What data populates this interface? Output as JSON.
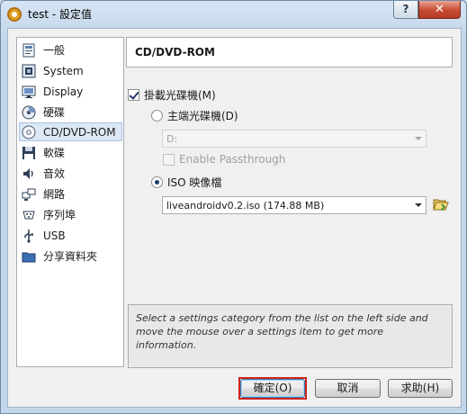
{
  "window": {
    "title": "test - 設定值",
    "help_label": "?",
    "close_label": "✕"
  },
  "sidebar": {
    "items": [
      {
        "label": "一般",
        "icon": "general-icon"
      },
      {
        "label": "System",
        "icon": "system-icon"
      },
      {
        "label": "Display",
        "icon": "display-icon"
      },
      {
        "label": "硬碟",
        "icon": "hard-disk-icon"
      },
      {
        "label": "CD/DVD-ROM",
        "icon": "cd-dvd-icon",
        "selected": true
      },
      {
        "label": "軟碟",
        "icon": "floppy-icon"
      },
      {
        "label": "音效",
        "icon": "audio-icon"
      },
      {
        "label": "網路",
        "icon": "network-icon"
      },
      {
        "label": "序列埠",
        "icon": "serial-port-icon"
      },
      {
        "label": "USB",
        "icon": "usb-icon"
      },
      {
        "label": "分享資料夾",
        "icon": "shared-folder-icon"
      }
    ]
  },
  "main": {
    "header": "CD/DVD-ROM",
    "mount_checkbox": {
      "label": "掛載光碟機(M)",
      "checked": true
    },
    "host_drive_radio": {
      "label": "主端光碟機(D)",
      "checked": false
    },
    "host_drive_combo": {
      "value": "D:"
    },
    "passthrough_checkbox": {
      "label": "Enable Passthrough",
      "checked": false,
      "enabled": false
    },
    "iso_radio": {
      "label": "ISO 映像檔",
      "checked": true
    },
    "iso_combo": {
      "value": "liveandroidv0.2.iso (174.88 MB)"
    },
    "info_text": "Select a settings category from the list on the left side and move the mouse over a settings item to get more information."
  },
  "buttons": {
    "ok": "確定(O)",
    "cancel": "取消",
    "help": "求助(H)"
  },
  "colors": {
    "focus_ring": "#d0221c",
    "selection_bg": "#dde8f5",
    "close_button": "#c74b34"
  }
}
